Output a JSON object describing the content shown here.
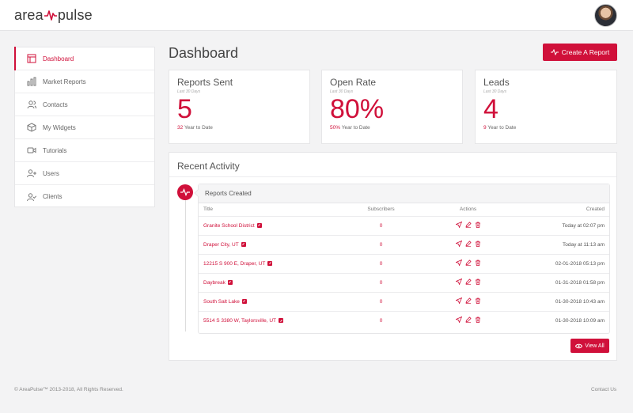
{
  "header": {
    "logo_left": "area",
    "logo_right": "pulse"
  },
  "sidebar": {
    "items": [
      {
        "label": "Dashboard",
        "icon": "layout-icon"
      },
      {
        "label": "Market Reports",
        "icon": "bar-chart-icon"
      },
      {
        "label": "Contacts",
        "icon": "users-icon"
      },
      {
        "label": "My Widgets",
        "icon": "box-icon"
      },
      {
        "label": "Tutorials",
        "icon": "video-icon"
      },
      {
        "label": "Users",
        "icon": "user-plus-icon"
      },
      {
        "label": "Clients",
        "icon": "user-check-icon"
      }
    ]
  },
  "main": {
    "title": "Dashboard",
    "create_label": "Create A Report"
  },
  "stats": [
    {
      "label": "Reports Sent",
      "period": "Last 30 Days",
      "value": "5",
      "ytd_value": "32",
      "ytd_label": "Year to Date"
    },
    {
      "label": "Open Rate",
      "period": "Last 30 Days",
      "value": "80%",
      "ytd_value": "50%",
      "ytd_label": "Year to Date"
    },
    {
      "label": "Leads",
      "period": "Last 30 Days",
      "value": "4",
      "ytd_value": "9",
      "ytd_label": "Year to Date"
    }
  ],
  "activity": {
    "title": "Recent Activity",
    "card_title": "Reports Created",
    "columns": {
      "title": "Title",
      "subscribers": "Subscribers",
      "actions": "Actions",
      "created": "Created"
    },
    "rows": [
      {
        "title": "Granite School District",
        "subscribers": "0",
        "created": "Today at 02:07 pm"
      },
      {
        "title": "Draper City, UT",
        "subscribers": "0",
        "created": "Today at 11:13 am"
      },
      {
        "title": "12215 S 900 E, Draper, UT",
        "subscribers": "0",
        "created": "02-01-2018 05:13 pm"
      },
      {
        "title": "Daybreak",
        "subscribers": "0",
        "created": "01-31-2018 01:58 pm"
      },
      {
        "title": "South Salt Lake",
        "subscribers": "0",
        "created": "01-30-2018 10:43 am"
      },
      {
        "title": "5514 S 3380 W, Taylorsville, UT",
        "subscribers": "0",
        "created": "01-30-2018 10:09 am"
      }
    ],
    "view_all_label": "View All"
  },
  "footer": {
    "copyright": "© AreaPulse™ 2013-2018, All Rights Reserved.",
    "contact": "Contact Us"
  },
  "colors": {
    "accent": "#d0103a",
    "background": "#f3f3f4"
  }
}
